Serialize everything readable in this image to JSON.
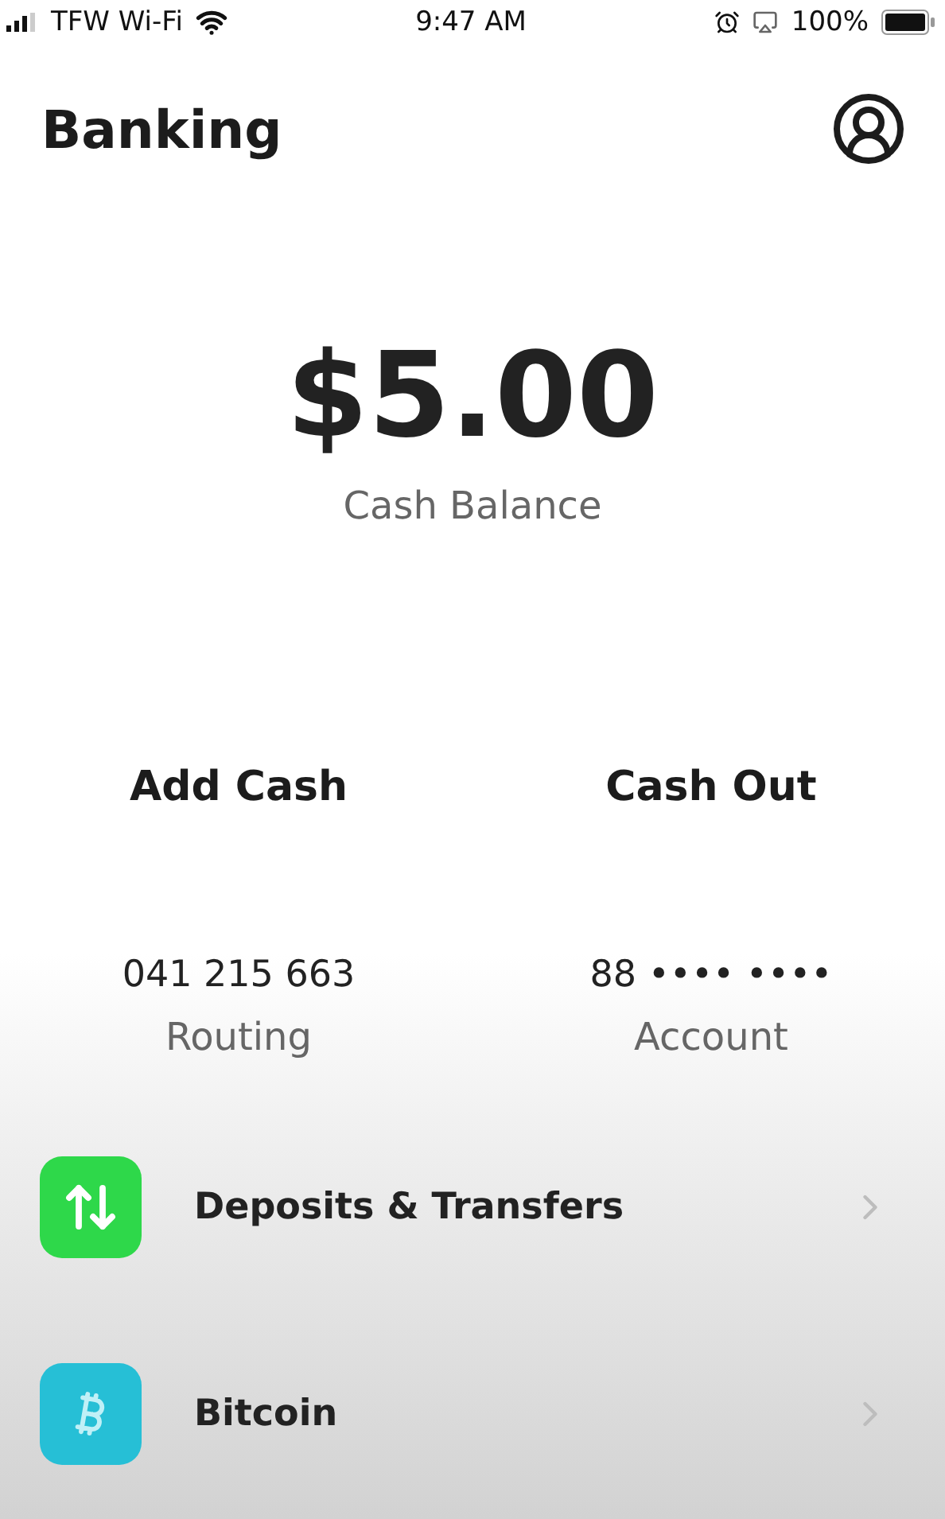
{
  "status_bar": {
    "carrier": "TFW Wi-Fi",
    "time": "9:47 AM",
    "battery": "100%"
  },
  "header": {
    "title": "Banking"
  },
  "balance": {
    "amount": "$5.00",
    "label": "Cash Balance"
  },
  "actions": [
    "Add Cash",
    "Cash Out"
  ],
  "account_info": [
    {
      "value": "041 215 663",
      "label": "Routing"
    },
    {
      "value": "88 •••• ••••",
      "label": "Account"
    }
  ],
  "menu": [
    {
      "kind": "transfers",
      "color": "#2ed84a",
      "label": "Deposits & Transfers"
    },
    {
      "kind": "bitcoin",
      "color": "#26bfd6",
      "label": "Bitcoin"
    }
  ]
}
